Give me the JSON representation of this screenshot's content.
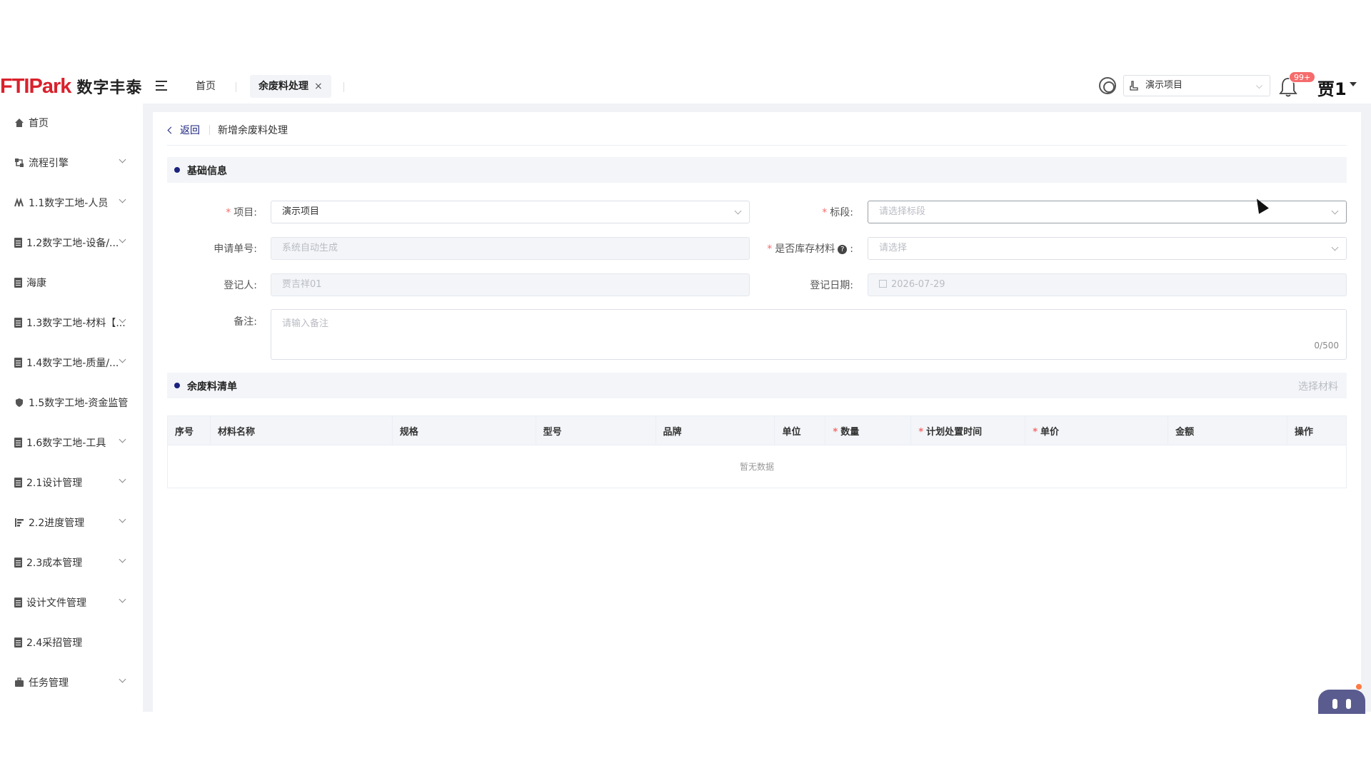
{
  "header": {
    "logo_en": "FTIPark",
    "logo_cn": "数字丰泰",
    "tabs": [
      {
        "label": "首页"
      },
      {
        "label": "余废料处理",
        "close": "×"
      }
    ],
    "project_select": "演示项目",
    "notification_badge": "99+",
    "user_name": "贾1"
  },
  "sidebar": {
    "items": [
      {
        "label": "首页",
        "icon": "home-icon"
      },
      {
        "label": "流程引擎",
        "icon": "workflow-icon"
      },
      {
        "label": "1.1数字工地-人员",
        "icon": "people-icon"
      },
      {
        "label": "1.2数字工地-设备/...",
        "icon": "doc-icon"
      },
      {
        "label": "海康",
        "icon": "doc-icon"
      },
      {
        "label": "1.3数字工地-材料【...",
        "icon": "doc-icon"
      },
      {
        "label": "1.4数字工地-质量/...",
        "icon": "doc-icon"
      },
      {
        "label": "1.5数字工地-资金监管",
        "icon": "shield-icon"
      },
      {
        "label": "1.6数字工地-工具",
        "icon": "doc-icon"
      },
      {
        "label": "2.1设计管理",
        "icon": "doc-icon"
      },
      {
        "label": "2.2进度管理",
        "icon": "gantt-icon"
      },
      {
        "label": "2.3成本管理",
        "icon": "doc-icon"
      },
      {
        "label": "设计文件管理",
        "icon": "doc-icon"
      },
      {
        "label": "2.4采招管理",
        "icon": "doc-icon"
      },
      {
        "label": "任务管理",
        "icon": "briefcase-icon"
      }
    ]
  },
  "page": {
    "back_label": "返回",
    "title": "新增余废料处理"
  },
  "basic_info": {
    "section_title": "基础信息",
    "project_label": "项目:",
    "project_value": "演示项目",
    "section_label": "标段:",
    "section_placeholder": "请选择标段",
    "apply_no_label": "申请单号:",
    "apply_no_placeholder": "系统自动生成",
    "is_stock_label": "是否库存材料",
    "is_stock_colon": ":",
    "is_stock_placeholder": "请选择",
    "registrant_label": "登记人:",
    "registrant_value": "贾吉祥01",
    "reg_date_label": "登记日期:",
    "reg_date_value": "2026-07-29",
    "remark_label": "备注:",
    "remark_placeholder": "请输入备注",
    "remark_counter": "0/500",
    "required_mark": "*",
    "help_mark": "?"
  },
  "materials": {
    "section_title": "余废料清单",
    "select_action": "选择材料",
    "columns": [
      "序号",
      "材料名称",
      "规格",
      "型号",
      "品牌",
      "单位",
      "数量",
      "计划处置时间",
      "单价",
      "金额",
      "操作"
    ],
    "required_columns": [
      6,
      7,
      8
    ],
    "empty_text": "暂无数据"
  },
  "colors": {
    "accent": "#1a237e",
    "brand_red": "#d9212c",
    "required": "#f56c6c"
  }
}
